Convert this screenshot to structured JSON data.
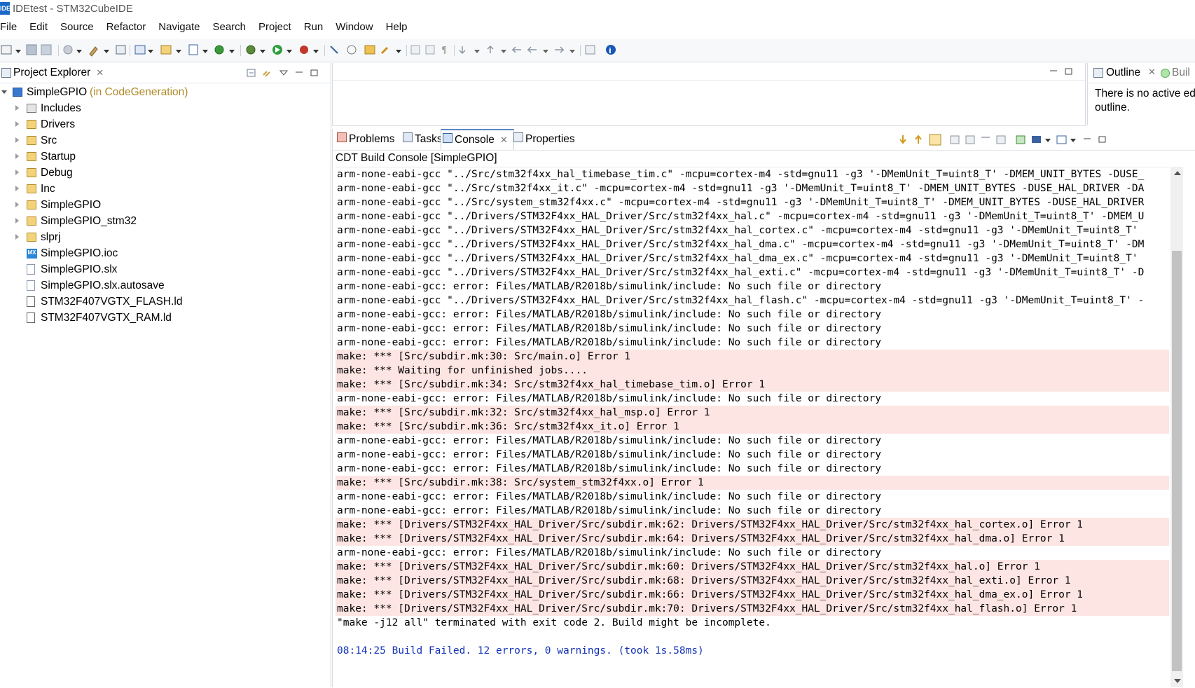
{
  "window": {
    "title": "IDEtest - STM32CubeIDE",
    "app_icon_text": "IDE"
  },
  "menu": [
    "File",
    "Edit",
    "Source",
    "Refactor",
    "Navigate",
    "Search",
    "Project",
    "Run",
    "Window",
    "Help"
  ],
  "project_explorer": {
    "tab_label": "Project Explorer",
    "project_name": "SimpleGPIO",
    "project_decoration": "(in CodeGeneration)",
    "items": [
      {
        "label": "Includes",
        "icon": "includes-icon"
      },
      {
        "label": "Drivers",
        "icon": "folder-icon"
      },
      {
        "label": "Src",
        "icon": "folder-icon"
      },
      {
        "label": "Startup",
        "icon": "folder-icon"
      },
      {
        "label": "Debug",
        "icon": "folder-icon"
      },
      {
        "label": "Inc",
        "icon": "folder-icon"
      },
      {
        "label": "SimpleGPIO",
        "icon": "folder-icon"
      },
      {
        "label": "SimpleGPIO_stm32",
        "icon": "folder-icon"
      },
      {
        "label": "slprj",
        "icon": "folder-icon"
      },
      {
        "label": "SimpleGPIO.ioc",
        "icon": "mx-icon",
        "icon_text": "MX"
      },
      {
        "label": "SimpleGPIO.slx",
        "icon": "file-icon"
      },
      {
        "label": "SimpleGPIO.slx.autosave",
        "icon": "file-icon"
      },
      {
        "label": "STM32F407VGTX_FLASH.ld",
        "icon": "ld-file-icon"
      },
      {
        "label": "STM32F407VGTX_RAM.ld",
        "icon": "ld-file-icon"
      }
    ]
  },
  "outline": {
    "tab_label": "Outline",
    "second_tab_label": "Buil",
    "message_line1": "There is no active ed",
    "message_line2": "outline."
  },
  "console": {
    "tabs": {
      "problems": "Problems",
      "tasks": "Tasks",
      "console": "Console",
      "properties": "Properties"
    },
    "title": "CDT Build Console [SimpleGPIO]",
    "lines": [
      {
        "text": "arm-none-eabi-gcc \"../Src/stm32f4xx_hal_timebase_tim.c\" -mcpu=cortex-m4 -std=gnu11 -g3 '-DMemUnit_T=uint8_T' -DMEM_UNIT_BYTES -DUSE_",
        "type": "normal"
      },
      {
        "text": "arm-none-eabi-gcc \"../Src/stm32f4xx_it.c\" -mcpu=cortex-m4 -std=gnu11 -g3 '-DMemUnit_T=uint8_T' -DMEM_UNIT_BYTES -DUSE_HAL_DRIVER -DA",
        "type": "normal"
      },
      {
        "text": "arm-none-eabi-gcc \"../Src/system_stm32f4xx.c\" -mcpu=cortex-m4 -std=gnu11 -g3 '-DMemUnit_T=uint8_T' -DMEM_UNIT_BYTES -DUSE_HAL_DRIVER",
        "type": "normal"
      },
      {
        "text": "arm-none-eabi-gcc \"../Drivers/STM32F4xx_HAL_Driver/Src/stm32f4xx_hal.c\" -mcpu=cortex-m4 -std=gnu11 -g3 '-DMemUnit_T=uint8_T' -DMEM_U",
        "type": "normal"
      },
      {
        "text": "arm-none-eabi-gcc \"../Drivers/STM32F4xx_HAL_Driver/Src/stm32f4xx_hal_cortex.c\" -mcpu=cortex-m4 -std=gnu11 -g3 '-DMemUnit_T=uint8_T'",
        "type": "normal"
      },
      {
        "text": "arm-none-eabi-gcc \"../Drivers/STM32F4xx_HAL_Driver/Src/stm32f4xx_hal_dma.c\" -mcpu=cortex-m4 -std=gnu11 -g3 '-DMemUnit_T=uint8_T' -DM",
        "type": "normal"
      },
      {
        "text": "arm-none-eabi-gcc \"../Drivers/STM32F4xx_HAL_Driver/Src/stm32f4xx_hal_dma_ex.c\" -mcpu=cortex-m4 -std=gnu11 -g3 '-DMemUnit_T=uint8_T'",
        "type": "normal"
      },
      {
        "text": "arm-none-eabi-gcc \"../Drivers/STM32F4xx_HAL_Driver/Src/stm32f4xx_hal_exti.c\" -mcpu=cortex-m4 -std=gnu11 -g3 '-DMemUnit_T=uint8_T' -D",
        "type": "normal"
      },
      {
        "text": "arm-none-eabi-gcc: error: Files/MATLAB/R2018b/simulink/include: No such file or directory",
        "type": "normal"
      },
      {
        "text": "arm-none-eabi-gcc \"../Drivers/STM32F4xx_HAL_Driver/Src/stm32f4xx_hal_flash.c\" -mcpu=cortex-m4 -std=gnu11 -g3 '-DMemUnit_T=uint8_T' -",
        "type": "normal"
      },
      {
        "text": "arm-none-eabi-gcc: error: Files/MATLAB/R2018b/simulink/include: No such file or directory",
        "type": "normal"
      },
      {
        "text": "arm-none-eabi-gcc: error: Files/MATLAB/R2018b/simulink/include: No such file or directory",
        "type": "normal"
      },
      {
        "text": "arm-none-eabi-gcc: error: Files/MATLAB/R2018b/simulink/include: No such file or directory",
        "type": "normal"
      },
      {
        "text": "make: *** [Src/subdir.mk:30: Src/main.o] Error 1",
        "type": "err"
      },
      {
        "text": "make: *** Waiting for unfinished jobs....",
        "type": "err"
      },
      {
        "text": "make: *** [Src/subdir.mk:34: Src/stm32f4xx_hal_timebase_tim.o] Error 1",
        "type": "err"
      },
      {
        "text": "arm-none-eabi-gcc: error: Files/MATLAB/R2018b/simulink/include: No such file or directory",
        "type": "normal"
      },
      {
        "text": "make: *** [Src/subdir.mk:32: Src/stm32f4xx_hal_msp.o] Error 1",
        "type": "err"
      },
      {
        "text": "make: *** [Src/subdir.mk:36: Src/stm32f4xx_it.o] Error 1",
        "type": "err"
      },
      {
        "text": "arm-none-eabi-gcc: error: Files/MATLAB/R2018b/simulink/include: No such file or directory",
        "type": "normal"
      },
      {
        "text": "arm-none-eabi-gcc: error: Files/MATLAB/R2018b/simulink/include: No such file or directory",
        "type": "normal"
      },
      {
        "text": "arm-none-eabi-gcc: error: Files/MATLAB/R2018b/simulink/include: No such file or directory",
        "type": "normal"
      },
      {
        "text": "make: *** [Src/subdir.mk:38: Src/system_stm32f4xx.o] Error 1",
        "type": "err"
      },
      {
        "text": "arm-none-eabi-gcc: error: Files/MATLAB/R2018b/simulink/include: No such file or directory",
        "type": "normal"
      },
      {
        "text": "arm-none-eabi-gcc: error: Files/MATLAB/R2018b/simulink/include: No such file or directory",
        "type": "normal"
      },
      {
        "text": "make: *** [Drivers/STM32F4xx_HAL_Driver/Src/subdir.mk:62: Drivers/STM32F4xx_HAL_Driver/Src/stm32f4xx_hal_cortex.o] Error 1",
        "type": "err"
      },
      {
        "text": "make: *** [Drivers/STM32F4xx_HAL_Driver/Src/subdir.mk:64: Drivers/STM32F4xx_HAL_Driver/Src/stm32f4xx_hal_dma.o] Error 1",
        "type": "err"
      },
      {
        "text": "arm-none-eabi-gcc: error: Files/MATLAB/R2018b/simulink/include: No such file or directory",
        "type": "normal"
      },
      {
        "text": "make: *** [Drivers/STM32F4xx_HAL_Driver/Src/subdir.mk:60: Drivers/STM32F4xx_HAL_Driver/Src/stm32f4xx_hal.o] Error 1",
        "type": "err"
      },
      {
        "text": "make: *** [Drivers/STM32F4xx_HAL_Driver/Src/subdir.mk:68: Drivers/STM32F4xx_HAL_Driver/Src/stm32f4xx_hal_exti.o] Error 1",
        "type": "err"
      },
      {
        "text": "make: *** [Drivers/STM32F4xx_HAL_Driver/Src/subdir.mk:66: Drivers/STM32F4xx_HAL_Driver/Src/stm32f4xx_hal_dma_ex.o] Error 1",
        "type": "err"
      },
      {
        "text": "make: *** [Drivers/STM32F4xx_HAL_Driver/Src/subdir.mk:70: Drivers/STM32F4xx_HAL_Driver/Src/stm32f4xx_hal_flash.o] Error 1",
        "type": "err"
      },
      {
        "text": "\"make -j12 all\" terminated with exit code 2. Build might be incomplete.",
        "type": "normal"
      },
      {
        "text": "",
        "type": "normal"
      },
      {
        "text": "08:14:25 Build Failed. 12 errors, 0 warnings. (took 1s.58ms)",
        "type": "info"
      }
    ]
  },
  "colors": {
    "error_bg": "#fde5e3",
    "info_text": "#1232b8",
    "project_decoration": "#b08a2a"
  }
}
